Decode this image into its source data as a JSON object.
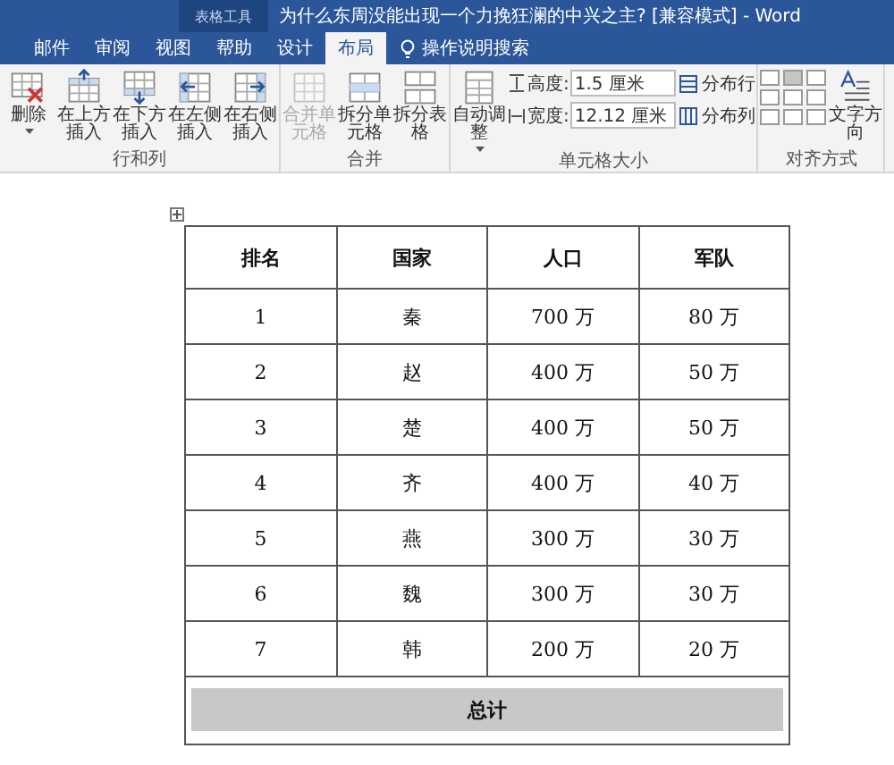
{
  "window": {
    "context_tab": "表格工具",
    "title": "为什么东周没能出现一个力挽狂澜的中兴之主? [兼容模式] - Word"
  },
  "tabs": [
    {
      "label": "邮件",
      "selected": false
    },
    {
      "label": "审阅",
      "selected": false
    },
    {
      "label": "视图",
      "selected": false
    },
    {
      "label": "帮助",
      "selected": false
    },
    {
      "label": "设计",
      "selected": false
    },
    {
      "label": "布局",
      "selected": true
    }
  ],
  "search": {
    "label": "操作说明搜索"
  },
  "ribbon": {
    "groups": [
      {
        "label": "行和列",
        "items": [
          {
            "kind": "delete",
            "label": "删除",
            "disabled": false,
            "dropdown": true
          },
          {
            "kind": "insert-above",
            "label": "在上方插入",
            "disabled": false
          },
          {
            "kind": "insert-below",
            "label": "在下方插入",
            "disabled": false
          },
          {
            "kind": "insert-left",
            "label": "在左侧插入",
            "disabled": false
          },
          {
            "kind": "insert-right",
            "label": "在右侧插入",
            "disabled": false
          }
        ]
      },
      {
        "label": "合并",
        "items": [
          {
            "kind": "merge",
            "label": "合并单元格",
            "disabled": true
          },
          {
            "kind": "split-cells",
            "label": "拆分单元格",
            "disabled": false
          },
          {
            "kind": "split-table",
            "label": "拆分表格",
            "disabled": false
          }
        ]
      },
      {
        "label": "单元格大小",
        "items": [
          {
            "kind": "autofit",
            "label": "自动调整",
            "disabled": false,
            "dropdown": true
          },
          {
            "kind": "size-fields",
            "fields": [
              {
                "label": "高度:",
                "value": "1.5 厘米"
              },
              {
                "label": "宽度:",
                "value": "12.12 厘米"
              }
            ]
          },
          {
            "kind": "distribute",
            "buttons": [
              "分布行",
              "分布列"
            ]
          }
        ]
      },
      {
        "label": "对齐方式",
        "items": [
          {
            "kind": "align-grid",
            "cells": [
              {
                "selected": false
              },
              {
                "selected": true
              },
              {
                "selected": false
              },
              {
                "selected": false
              },
              {
                "selected": false
              },
              {
                "selected": false
              },
              {
                "selected": false
              },
              {
                "selected": false
              },
              {
                "selected": false
              }
            ]
          },
          {
            "kind": "text-direction",
            "label": "文字方向",
            "disabled": false
          }
        ]
      }
    ]
  },
  "table": {
    "columns": [
      "排名",
      "国家",
      "人口",
      "军队"
    ],
    "rows": [
      [
        "1",
        "秦",
        "700 万",
        "80 万"
      ],
      [
        "2",
        "赵",
        "400 万",
        "50 万"
      ],
      [
        "3",
        "楚",
        "400 万",
        "50 万"
      ],
      [
        "4",
        "齐",
        "400 万",
        "40 万"
      ],
      [
        "5",
        "燕",
        "300 万",
        "30 万"
      ],
      [
        "6",
        "魏",
        "300 万",
        "30 万"
      ],
      [
        "7",
        "韩",
        "200 万",
        "20 万"
      ]
    ],
    "total": {
      "label": "总计",
      "selected": true
    }
  }
}
